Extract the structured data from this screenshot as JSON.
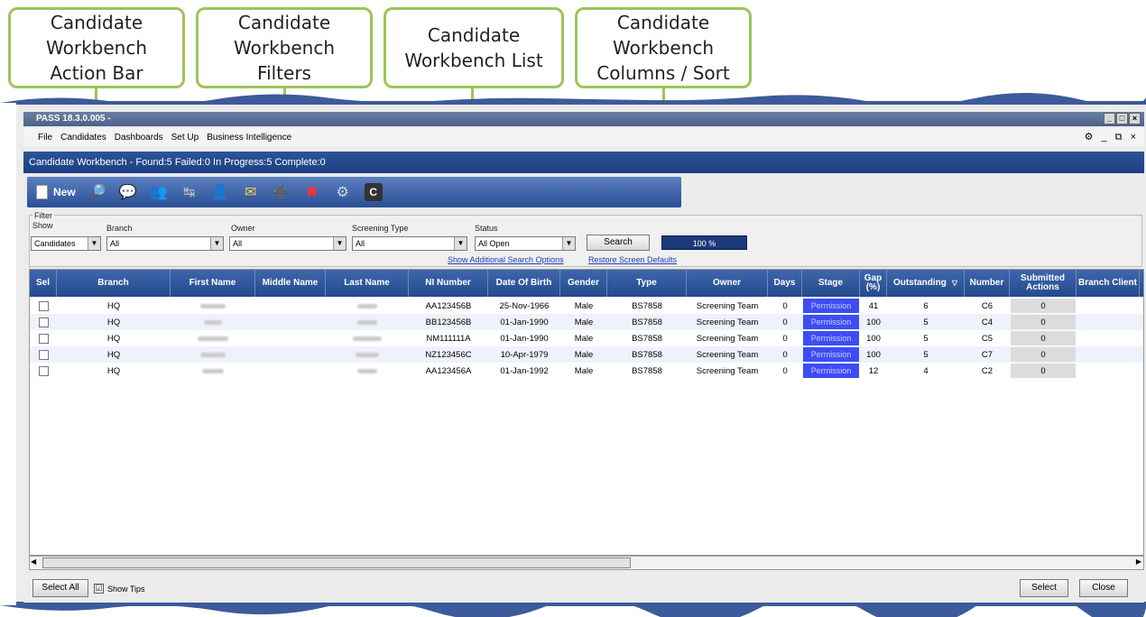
{
  "callouts": {
    "action_bar": "Candidate\nWorkbench\nAction Bar",
    "filters": "Candidate\nWorkbench\nFilters",
    "list": "Candidate\nWorkbench List",
    "columns": "Candidate\nWorkbench\nColumns / Sort"
  },
  "window": {
    "title": "PASS 18.3.0.005 -",
    "min_glyph": "_",
    "max_glyph": "□",
    "close_glyph": "×"
  },
  "menu": [
    "File",
    "Candidates",
    "Dashboards",
    "Set Up",
    "Business Intelligence"
  ],
  "menu_right": "⚙ _ ⧉ ×",
  "workbench_status": "Candidate Workbench - Found:5 Failed:0 In Progress:5 Complete:0",
  "action_bar": {
    "new_label": "New",
    "icons": [
      "search-icon",
      "comment-icon",
      "people-icon",
      "transfer-icon",
      "add-person-icon",
      "mail-icon",
      "assign-icon",
      "delete-icon",
      "settings-icon",
      "refresh-icon"
    ],
    "glyphs": [
      "🔎",
      "💬",
      "👥",
      "↹",
      "👤",
      "✉",
      "➕",
      "✖",
      "⚙",
      "C"
    ]
  },
  "filter": {
    "group_label": "Filter",
    "show_label": "Show",
    "show_value": "Candidates",
    "branch_label": "Branch",
    "branch_value": "All",
    "owner_label": "Owner",
    "owner_value": "All",
    "screening_label": "Screening Type",
    "screening_value": "All",
    "status_label": "Status",
    "status_value": "All Open",
    "search_button": "Search",
    "progress_text": "100 %",
    "progress_fraction": 1.0,
    "additional_link": "Show Additional Search Options",
    "restore_link": "Restore Screen Defaults"
  },
  "grid": {
    "columns": [
      "Sel",
      "Branch",
      "First Name",
      "Middle Name",
      "Last Name",
      "NI Number",
      "Date Of Birth",
      "Gender",
      "Type",
      "Owner",
      "Days",
      "Stage",
      "Gap (%)",
      "Outstanding",
      "Number",
      "Submitted Actions",
      "Branch Client"
    ],
    "sort_glyph": "▽",
    "rows": [
      {
        "branch": "HQ",
        "ni": "AA123456B",
        "dob": "25-Nov-1966",
        "gender": "Male",
        "type": "BS7858",
        "owner": "Screening Team",
        "days": "0",
        "stage": "Permission",
        "gap": "41",
        "outstanding": "6",
        "number": "C6",
        "submitted": "0"
      },
      {
        "branch": "HQ",
        "ni": "BB123456B",
        "dob": "01-Jan-1990",
        "gender": "Male",
        "type": "BS7858",
        "owner": "Screening Team",
        "days": "0",
        "stage": "Permission",
        "gap": "100",
        "outstanding": "5",
        "number": "C4",
        "submitted": "0"
      },
      {
        "branch": "HQ",
        "ni": "NM111111A",
        "dob": "01-Jan-1990",
        "gender": "Male",
        "type": "BS7858",
        "owner": "Screening Team",
        "days": "0",
        "stage": "Permission",
        "gap": "100",
        "outstanding": "5",
        "number": "C5",
        "submitted": "0"
      },
      {
        "branch": "HQ",
        "ni": "NZ123456C",
        "dob": "10-Apr-1979",
        "gender": "Male",
        "type": "BS7858",
        "owner": "Screening Team",
        "days": "0",
        "stage": "Permission",
        "gap": "100",
        "outstanding": "5",
        "number": "C7",
        "submitted": "0"
      },
      {
        "branch": "HQ",
        "ni": "AA123456A",
        "dob": "01-Jan-1992",
        "gender": "Male",
        "type": "BS7858",
        "owner": "Screening Team",
        "days": "0",
        "stage": "Permission",
        "gap": "12",
        "outstanding": "4",
        "number": "C2",
        "submitted": "0"
      }
    ]
  },
  "footer": {
    "select_all": "Select All",
    "show_tips": "Show Tips",
    "show_tips_checked": "☑",
    "select": "Select",
    "close": "Close"
  },
  "colors": {
    "callout_border": "#9dc45a",
    "header_blue": "#244a8e",
    "stage_blue": "#3c4df5"
  }
}
